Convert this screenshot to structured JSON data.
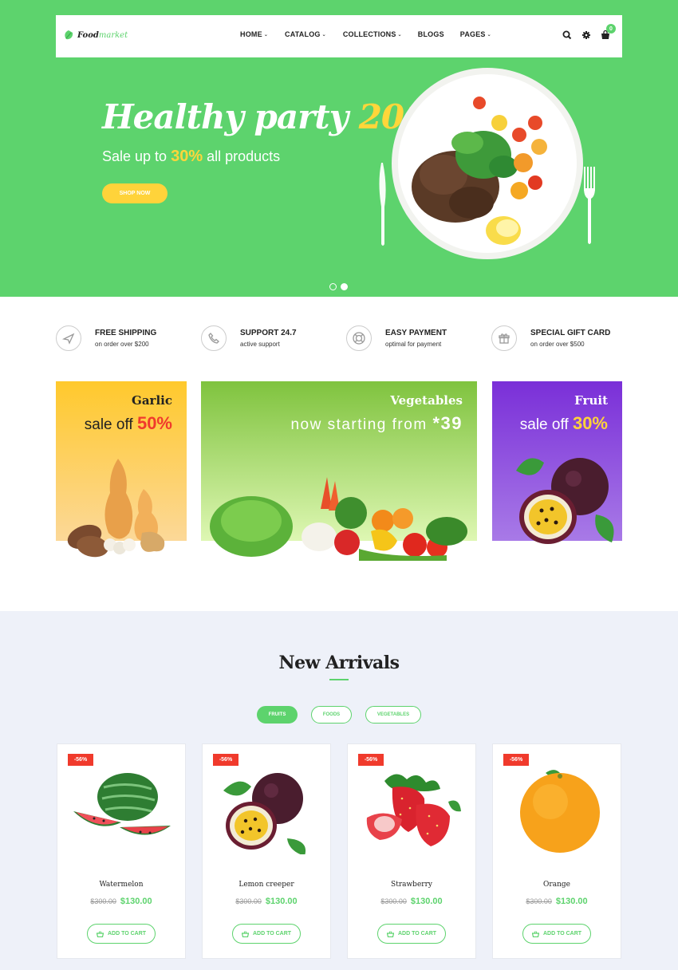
{
  "brand": {
    "logo_bold": "Food",
    "logo_light": "market"
  },
  "nav": {
    "items": [
      {
        "label": "HOME",
        "has_caret": true
      },
      {
        "label": "CATALOG",
        "has_caret": true
      },
      {
        "label": "COLLECTIONS",
        "has_caret": true
      },
      {
        "label": "BLOGS",
        "has_caret": false
      },
      {
        "label": "PAGES",
        "has_caret": true
      }
    ],
    "cart_count": "0",
    "icons": [
      "search-icon",
      "gear-icon",
      "cart-icon"
    ]
  },
  "hero": {
    "title": "Healthy party",
    "title_year": "2017",
    "subtitle_prefix": "Sale up to",
    "subtitle_pct": "30%",
    "subtitle_suffix": "all products",
    "cta": "SHOP NOW",
    "slides": 2,
    "active_slide": 2
  },
  "features": [
    {
      "title": "FREE SHIPPING",
      "sub": "on order over $200",
      "icon": "airplane-icon"
    },
    {
      "title": "SUPPORT 24.7",
      "sub": "active support",
      "icon": "phone-icon"
    },
    {
      "title": "EASY PAYMENT",
      "sub": "optimal for payment",
      "icon": "lifebuoy-icon"
    },
    {
      "title": "SPECIAL GIFT CARD",
      "sub": "on order over $500",
      "icon": "gift-icon"
    }
  ],
  "banners": [
    {
      "title": "Garlic",
      "text": "sale off",
      "highlight": "50%"
    },
    {
      "title": "Vegetables",
      "text": "now starting from",
      "highlight": "*39"
    },
    {
      "title": "Fruit",
      "text": "sale off",
      "highlight": "30%"
    }
  ],
  "arrivals": {
    "title": "New Arrivals",
    "tabs": [
      {
        "label": "FRUITS",
        "active": true
      },
      {
        "label": "FOODS",
        "active": false
      },
      {
        "label": "VEGETABLES",
        "active": false
      }
    ],
    "add_to_cart": "ADD TO CART",
    "products": [
      {
        "name": "Watermelon",
        "discount": "-56%",
        "old_price": "$300.00",
        "price": "$130.00"
      },
      {
        "name": "Lemon creeper",
        "discount": "-56%",
        "old_price": "$300.00",
        "price": "$130.00"
      },
      {
        "name": "Strawberry",
        "discount": "-56%",
        "old_price": "$300.00",
        "price": "$130.00"
      },
      {
        "name": "Orange",
        "discount": "-56%",
        "old_price": "$300.00",
        "price": "$130.00"
      }
    ]
  },
  "colors": {
    "brand_green": "#5dd36d",
    "accent_yellow": "#ffd33a",
    "sale_red": "#f03a2c"
  }
}
